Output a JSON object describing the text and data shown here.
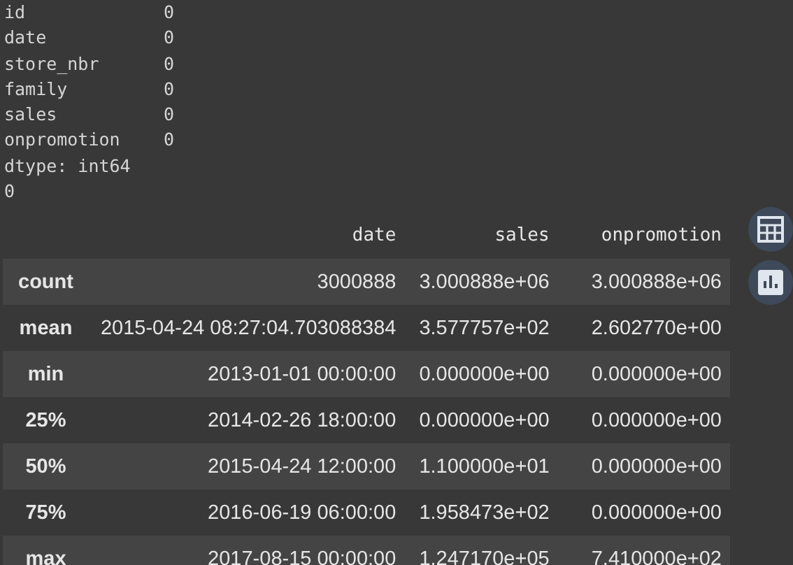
{
  "null_counts": [
    {
      "name": "id",
      "value": "0"
    },
    {
      "name": "date",
      "value": "0"
    },
    {
      "name": "store_nbr",
      "value": "0"
    },
    {
      "name": "family",
      "value": "0"
    },
    {
      "name": "sales",
      "value": "0"
    },
    {
      "name": "onpromotion",
      "value": "0"
    }
  ],
  "dtype": "dtype: int64",
  "output_value": "0",
  "table": {
    "columns": [
      "date",
      "sales",
      "onpromotion"
    ],
    "rows": [
      {
        "index": "count",
        "cells": [
          "3000888",
          "3.000888e+06",
          "3.000888e+06"
        ]
      },
      {
        "index": "mean",
        "cells": [
          "2015-04-24 08:27:04.703088384",
          "3.577757e+02",
          "2.602770e+00"
        ]
      },
      {
        "index": "min",
        "cells": [
          "2013-01-01 00:00:00",
          "0.000000e+00",
          "0.000000e+00"
        ]
      },
      {
        "index": "25%",
        "cells": [
          "2014-02-26 18:00:00",
          "0.000000e+00",
          "0.000000e+00"
        ]
      },
      {
        "index": "50%",
        "cells": [
          "2015-04-24 12:00:00",
          "1.100000e+01",
          "0.000000e+00"
        ]
      },
      {
        "index": "75%",
        "cells": [
          "2016-06-19 06:00:00",
          "1.958473e+02",
          "0.000000e+00"
        ]
      },
      {
        "index": "max",
        "cells": [
          "2017-08-15 00:00:00",
          "1.247170e+05",
          "7.410000e+02"
        ]
      }
    ]
  }
}
